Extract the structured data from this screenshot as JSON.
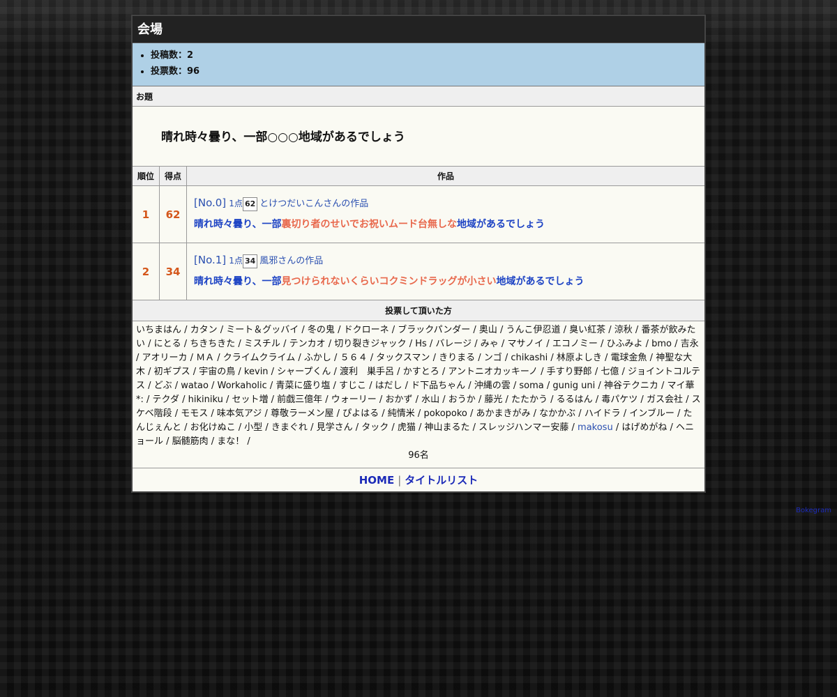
{
  "venue": {
    "title": "会場",
    "stats": [
      {
        "label": "投稿数：2"
      },
      {
        "label": "投票数：96"
      }
    ]
  },
  "odai": {
    "head": "お題",
    "text": "晴れ時々曇り、一部○○○地域があるでしょう"
  },
  "results": {
    "headers": {
      "rank": "順位",
      "score": "得点",
      "work": "作品"
    },
    "rows": [
      {
        "rank": "1",
        "score": "62",
        "no": "[No.0]",
        "pt_label": "1点",
        "pt_count": "62",
        "author": "とけつだいこんさんの作品",
        "prefix": "晴れ時々曇り、一部",
        "fill": "裏切り者のせいでお祝いムード台無しな",
        "suffix": "地域があるでしょう"
      },
      {
        "rank": "2",
        "score": "34",
        "no": "[No.1]",
        "pt_label": "1点",
        "pt_count": "34",
        "author": "風邪さんの作品",
        "prefix": "晴れ時々曇り、一部",
        "fill": "見つけられないくらいコクミンドラッグが小さい",
        "suffix": "地域があるでしょう"
      }
    ]
  },
  "voters": {
    "head": "投票して頂いた方",
    "list_before_link": "いちまはん / カタン / ミート＆グッバイ / 冬の鬼 / ドクローネ / ブラックパンダー / 奥山 / うんこ伊忍道 / 臭い紅茶 / 涼秋 / 番茶が飲みたい / にとる / ちきちきた / ミスチル / テンカオ / 切り裂きジャック / Hs / バレージ / みゃ / マサノイ / エコノミー / ひふみよ / bmo / 吉永 / アオリーカ / ＭＡ / クライムクライム / ふかし / ５６４ / タックスマン / きりまる / ンゴ / chikashi / 林原よしき / 電球金魚 / 神聖な大木 / 初ギプス / 宇宙の鳥 / kevin / シャープくん / 渡利　巣手呂 / かすとろ / アントニオカッキーノ / 手すり野郎 / 七億 / ジョイントコルテス / どぶ / watao / Workaholic / 青菜に盛り塩 / すじこ / はだし / ド下品ちゃん / 沖縄の雲 / soma / gunig uni / 神谷テクニカ / マイ華*: / テクダ / hikiniku / セット増 / 前戯三億年 / ウォーリー / おかず / 水山 / おうか / 藤光 / たたかう / るるはん / 毒パケツ / ガス会社 / スケベ階段 / モモス / 味本気アジ / 尊敬ラーメン屋 / ぴよはる / 純情米 / pokopoko / あかまきがみ / なかかぶ / ハイドラ / インブルー / たんじぇんと / お化けぬこ / 小型 / きまぐれ / 見学さん / タック / 虎猫 / 神山まるた / スレッジハンマー安藤 / ",
    "link_name": "makosu",
    "list_after_link": " / はげめがね / ヘニョール / 脳髄筋肉 / まな！ /",
    "count": "96名"
  },
  "footer": {
    "home": "HOME",
    "sep": "|",
    "title_list": "タイトルリスト"
  },
  "credit": "Bokegram"
}
